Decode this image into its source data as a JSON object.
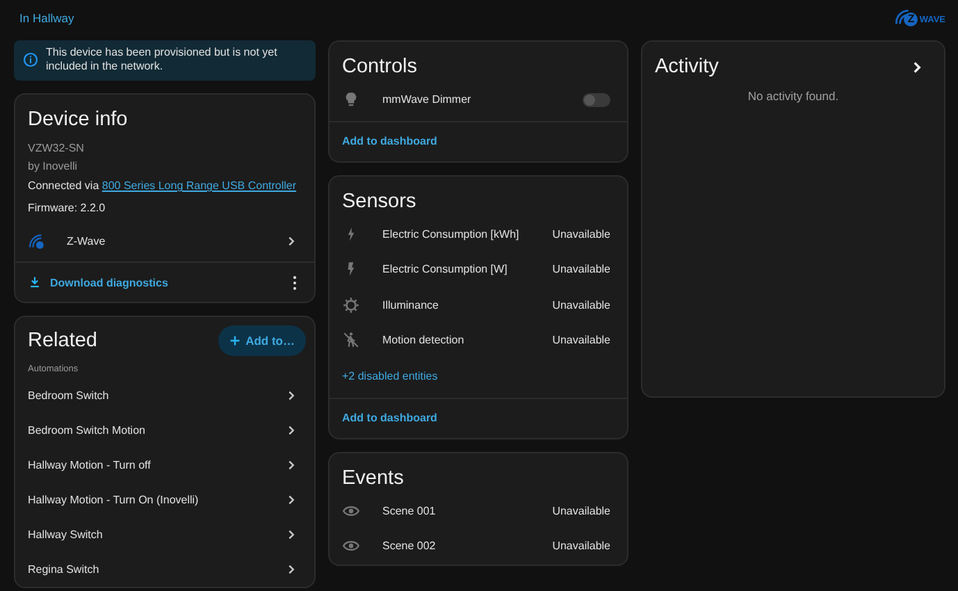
{
  "header": {
    "area_link": "In Hallway",
    "logo": {
      "mark": "Z",
      "wordmark": "WAVE"
    }
  },
  "notice": "This device has been provisioned but is not yet included in the network.",
  "device_info": {
    "title": "Device info",
    "model": "VZW32-SN",
    "manufacturer": "by Inovelli",
    "connected_prefix": "Connected via",
    "connected_link": "800 Series Long Range USB Controller",
    "firmware": "Firmware: 2.2.0",
    "integration": "Z-Wave",
    "download": "Download diagnostics"
  },
  "related": {
    "title": "Related",
    "add_button": "Add to…",
    "section": "Automations",
    "items": [
      {
        "name": "Bedroom Switch"
      },
      {
        "name": "Bedroom Switch Motion"
      },
      {
        "name": "Hallway Motion - Turn off"
      },
      {
        "name": "Hallway Motion - Turn On (Inovelli)"
      },
      {
        "name": "Hallway Switch"
      },
      {
        "name": "Regina Switch"
      }
    ]
  },
  "controls": {
    "title": "Controls",
    "items": [
      {
        "kind": "light",
        "name": "mmWave Dimmer",
        "on": false
      }
    ],
    "add_link": "Add to dashboard"
  },
  "sensors": {
    "title": "Sensors",
    "items": [
      {
        "kind": "energy",
        "name": "Electric Consumption [kWh]",
        "state": "Unavailable"
      },
      {
        "kind": "power",
        "name": "Electric Consumption [W]",
        "state": "Unavailable"
      },
      {
        "kind": "illuminance",
        "name": "Illuminance",
        "state": "Unavailable"
      },
      {
        "kind": "motion",
        "name": "Motion detection",
        "state": "Unavailable"
      }
    ],
    "disabled_link": "+2 disabled entities",
    "add_link": "Add to dashboard"
  },
  "events": {
    "title": "Events",
    "items": [
      {
        "kind": "event",
        "name": "Scene 001",
        "state": "Unavailable"
      },
      {
        "kind": "event",
        "name": "Scene 002",
        "state": "Unavailable"
      }
    ]
  },
  "activity": {
    "title": "Activity",
    "empty": "No activity found."
  }
}
